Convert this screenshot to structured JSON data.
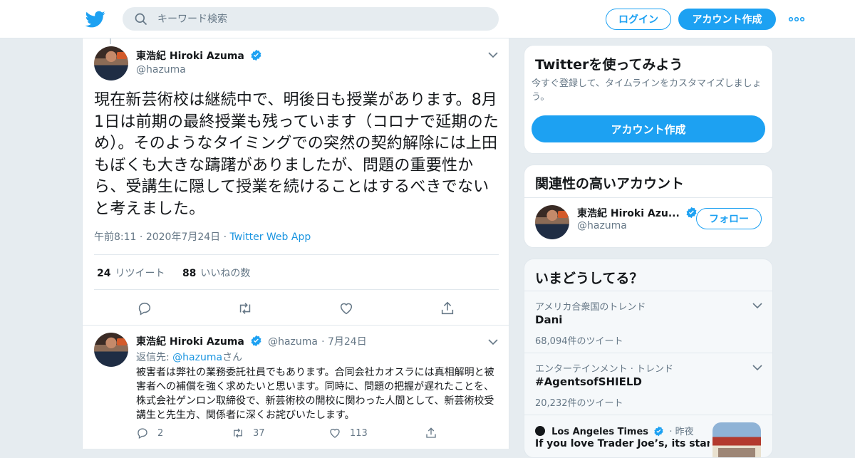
{
  "header": {
    "search_placeholder": "キーワード検索",
    "login_label": "ログイン",
    "signup_label": "アカウント作成",
    "brand_color": "#1da1f2"
  },
  "tweet": {
    "display_name": "東浩紀 Hiroki Azuma",
    "handle": "@hazuma",
    "text": "現在新芸術校は継続中で、明後日も授業があります。8月1日は前期の最終授業も残っています（コロナで延期のため）。そのようなタイミングでの突然の契約解除には上田もぼくも大きな躊躇がありましたが、問題の重要性から、受講生に隠して授業を続けることはするべきでないと考えました。",
    "time": "午前8:11",
    "date": "2020年7月24日",
    "app": "Twitter Web App",
    "retweets_count": "24",
    "retweets_label": "リツイート",
    "likes_count": "88",
    "likes_label": "いいねの数"
  },
  "reply": {
    "display_name": "東浩紀 Hiroki Azuma",
    "handle": "@hazuma",
    "date": "7月24日",
    "reply_prefix": "返信先: ",
    "reply_handle": "@hazuma",
    "reply_suffix": "さん",
    "text": "被害者は弊社の業務委託社員でもあります。合同会社カオスラには真相解明と被害者への補償を強く求めたいと思います。同時に、問題の把握が遅れたことを、株式会社ゲンロン取締役で、新芸術校の開校に関わった人間として、新芸術校受講生と先生方、関係者に深くお詫びいたします。",
    "replies": "2",
    "retweets": "37",
    "likes": "113"
  },
  "signup_card": {
    "title": "Twitterを使ってみよう",
    "subtitle": "今すぐ登録して、タイムラインをカスタマイズしましょう。",
    "button": "アカウント作成"
  },
  "related_card": {
    "title": "関連性の高いアカウント",
    "name": "東浩紀 Hiroki Azu...",
    "handle": "@hazuma",
    "follow": "フォロー"
  },
  "trends_card": {
    "title": "いまどうしてる？",
    "items": [
      {
        "context": "アメリカ合衆国のトレンド",
        "name": "Dani",
        "count": "68,094件のツイート"
      },
      {
        "context": "エンターテインメント · トレンド",
        "name": "#AgentsofSHIELD",
        "count": "20,232件のツイート"
      }
    ],
    "news": {
      "source": "Los Angeles Times",
      "time": "· 昨夜",
      "headline": "If you love Trader Joe’s, its stances"
    }
  }
}
